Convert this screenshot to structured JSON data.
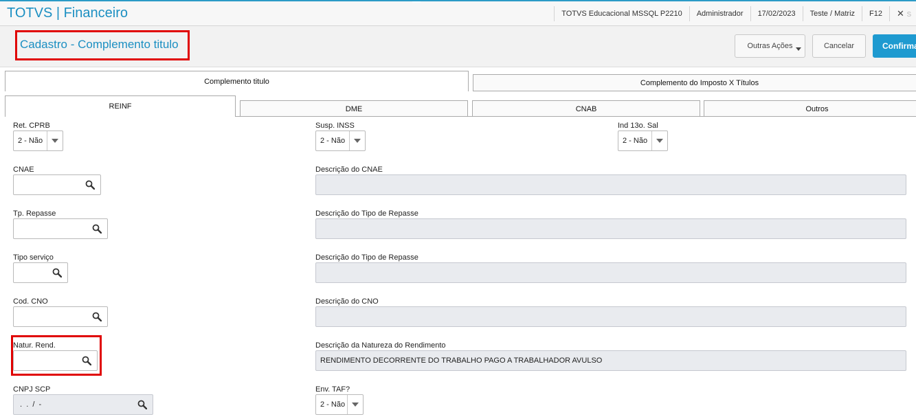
{
  "app": {
    "title": "TOTVS | Financeiro"
  },
  "status": {
    "environment": "TOTVS Educacional MSSQL P2210",
    "user": "Administrador",
    "date": "17/02/2023",
    "branch": "Teste / Matriz",
    "key": "F12",
    "close_symbol": "✕",
    "close_label": "S"
  },
  "header": {
    "title": "Cadastro - Complemento titulo",
    "more_actions": "Outras Ações",
    "cancel": "Cancelar",
    "confirm": "Confirmar"
  },
  "tabs": {
    "main": [
      "Complemento titulo",
      "Complemento do Imposto X Títulos"
    ],
    "sub": [
      "REINF",
      "DME",
      "CNAB",
      "Outros"
    ]
  },
  "form": {
    "ret_cprb": {
      "label": "Ret. CPRB",
      "value": "2 - Não"
    },
    "susp_inss": {
      "label": "Susp. INSS",
      "value": "2 - Não"
    },
    "ind_13": {
      "label": "Ind 13o. Sal",
      "value": "2 - Não"
    },
    "cnae": {
      "label": "CNAE",
      "value": ""
    },
    "cnae_desc": {
      "label": "Descrição do CNAE",
      "value": ""
    },
    "tp_repasse": {
      "label": "Tp. Repasse",
      "value": ""
    },
    "tp_repasse_desc": {
      "label": "Descrição do Tipo de Repasse",
      "value": ""
    },
    "tipo_servico": {
      "label": "Tipo serviço",
      "value": ""
    },
    "tipo_servico_desc": {
      "label": "Descrição do Tipo de Repasse",
      "value": ""
    },
    "cod_cno": {
      "label": "Cod. CNO",
      "value": ""
    },
    "cno_desc": {
      "label": "Descrição do CNO",
      "value": ""
    },
    "natur_rend": {
      "label": "Natur. Rend.",
      "value": ""
    },
    "natur_rend_desc": {
      "label": "Descrição da Natureza do Rendimento",
      "value": "RENDIMENTO DECORRENTE DO TRABALHO PAGO A TRABALHADOR AVULSO"
    },
    "cnpj_scp": {
      "label": "CNPJ SCP",
      "value": " .  .  /  -"
    },
    "env_taf": {
      "label": "Env. TAF?",
      "value": "2 - Não"
    }
  },
  "colors": {
    "accent": "#1b8fc2",
    "confirm": "#1e9ad0",
    "highlight": "#e00000",
    "readonly": "#e9ebef"
  }
}
